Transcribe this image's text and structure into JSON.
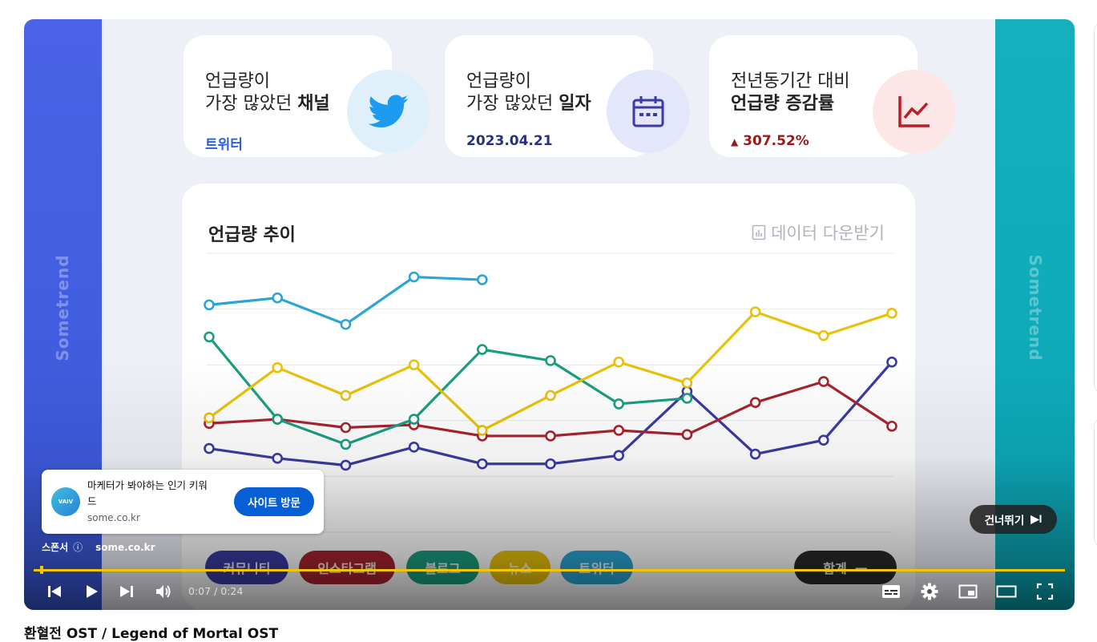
{
  "video": {
    "brand_text": "Sometrend",
    "cards": [
      {
        "line1": "언급량이",
        "line2_plain": "가장 많았던 ",
        "line2_bold": "채널",
        "value": "트위터",
        "value_color": "#2a5fd8",
        "circle_color": "#dff0fb",
        "icon": "twitter-bird-icon"
      },
      {
        "line1": "언급량이",
        "line2_plain": "가장 많았던 ",
        "line2_bold": "일자",
        "value": "2023.04.21",
        "value_color": "#2a2f7e",
        "circle_color": "#e4e7fb",
        "icon": "calendar-icon"
      },
      {
        "line1": "전년동기간 대비",
        "line2_plain": "",
        "line2_bold": "언급량 증감률",
        "value": "307.52%",
        "value_prefix": "▲",
        "value_color": "#9a1a1a",
        "circle_color": "#fde6e6",
        "icon": "line-chart-icon"
      }
    ],
    "panel": {
      "title": "언급량 추이",
      "download_label": "데이터 다운받기"
    },
    "chart_data": {
      "type": "line",
      "x": [
        1,
        2,
        3,
        4,
        5,
        6,
        7,
        8,
        9,
        10,
        11
      ],
      "grid": true,
      "series": [
        {
          "name": "커뮤니티",
          "color": "#3b3aa3",
          "values": [
            6,
            5.3,
            4.8,
            6.1,
            4.9,
            4.9,
            5.5,
            10.1,
            5.6,
            6.6,
            12.2
          ]
        },
        {
          "name": "인스타그램",
          "color": "#a8232f",
          "values": [
            7.8,
            8.1,
            7.5,
            7.7,
            6.9,
            6.9,
            7.3,
            7,
            9.3,
            10.8,
            7.6
          ]
        },
        {
          "name": "블로그",
          "color": "#1a9e80",
          "values": [
            14,
            8.1,
            6.3,
            8.1,
            13.1,
            12.3,
            9.2,
            9.6,
            null,
            null,
            null
          ]
        },
        {
          "name": "뉴스",
          "color": "#e8c20a",
          "values": [
            8.2,
            11.8,
            9.8,
            12,
            7.3,
            9.8,
            12.2,
            10.7,
            15.8,
            14.1,
            15.7
          ]
        },
        {
          "name": "트위터",
          "color": "#2aa5d4",
          "values": [
            16.3,
            16.8,
            14.9,
            18.3,
            18.1,
            null,
            null,
            null,
            null,
            null,
            null
          ]
        }
      ],
      "ylim": [
        0,
        20
      ]
    },
    "legend_total_label": "합계",
    "legend_total_symbol": "—"
  },
  "ad": {
    "logo_text": "VAIV",
    "title": "마케터가 봐야하는 인기 키워드",
    "domain": "some.co.kr",
    "cta_label": "사이트 방문",
    "sponsor_label": "스폰서",
    "info_symbol": "ⓘ"
  },
  "skip": {
    "label": "건너뛰기",
    "symbol": "▶I"
  },
  "controls": {
    "time": "0:07 / 0:24",
    "progress_percent": 0.3
  },
  "title": "환혈전 OST / Legend of Mortal OST"
}
